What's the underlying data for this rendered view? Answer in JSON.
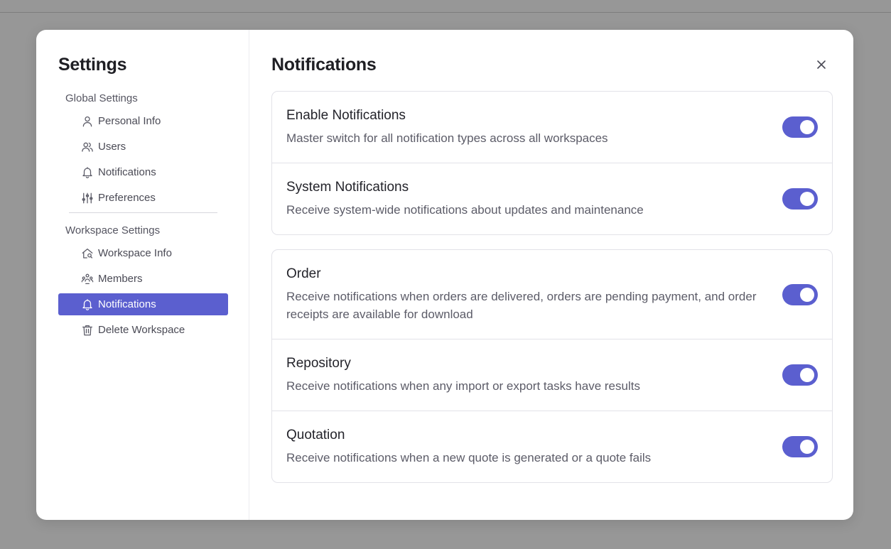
{
  "sidebar": {
    "title": "Settings",
    "global_label": "Global Settings",
    "global_items": [
      {
        "label": "Personal Info",
        "icon": "person-icon"
      },
      {
        "label": "Users",
        "icon": "users-icon"
      },
      {
        "label": "Notifications",
        "icon": "bell-icon"
      },
      {
        "label": "Preferences",
        "icon": "sliders-icon"
      }
    ],
    "workspace_label": "Workspace Settings",
    "workspace_items": [
      {
        "label": "Workspace Info",
        "icon": "home-search-icon"
      },
      {
        "label": "Members",
        "icon": "members-icon"
      },
      {
        "label": "Notifications",
        "icon": "bell-icon",
        "active": true
      },
      {
        "label": "Delete Workspace",
        "icon": "trash-icon"
      }
    ]
  },
  "main": {
    "title": "Notifications",
    "close_icon": "close-icon",
    "cards": [
      [
        {
          "title": "Enable Notifications",
          "desc": "Master switch for all notification types across all workspaces",
          "enabled": true
        },
        {
          "title": "System Notifications",
          "desc": "Receive system-wide notifications about updates and maintenance",
          "enabled": true
        }
      ],
      [
        {
          "title": "Order",
          "desc": "Receive notifications when orders are delivered, orders are pending payment, and order receipts are available for download",
          "enabled": true
        },
        {
          "title": "Repository",
          "desc": "Receive notifications when any import or export tasks have results",
          "enabled": true
        },
        {
          "title": "Quotation",
          "desc": "Receive notifications when a new quote is generated or a quote fails",
          "enabled": true
        }
      ]
    ]
  },
  "colors": {
    "accent": "#5b5fcf",
    "overlay": "#979797"
  }
}
